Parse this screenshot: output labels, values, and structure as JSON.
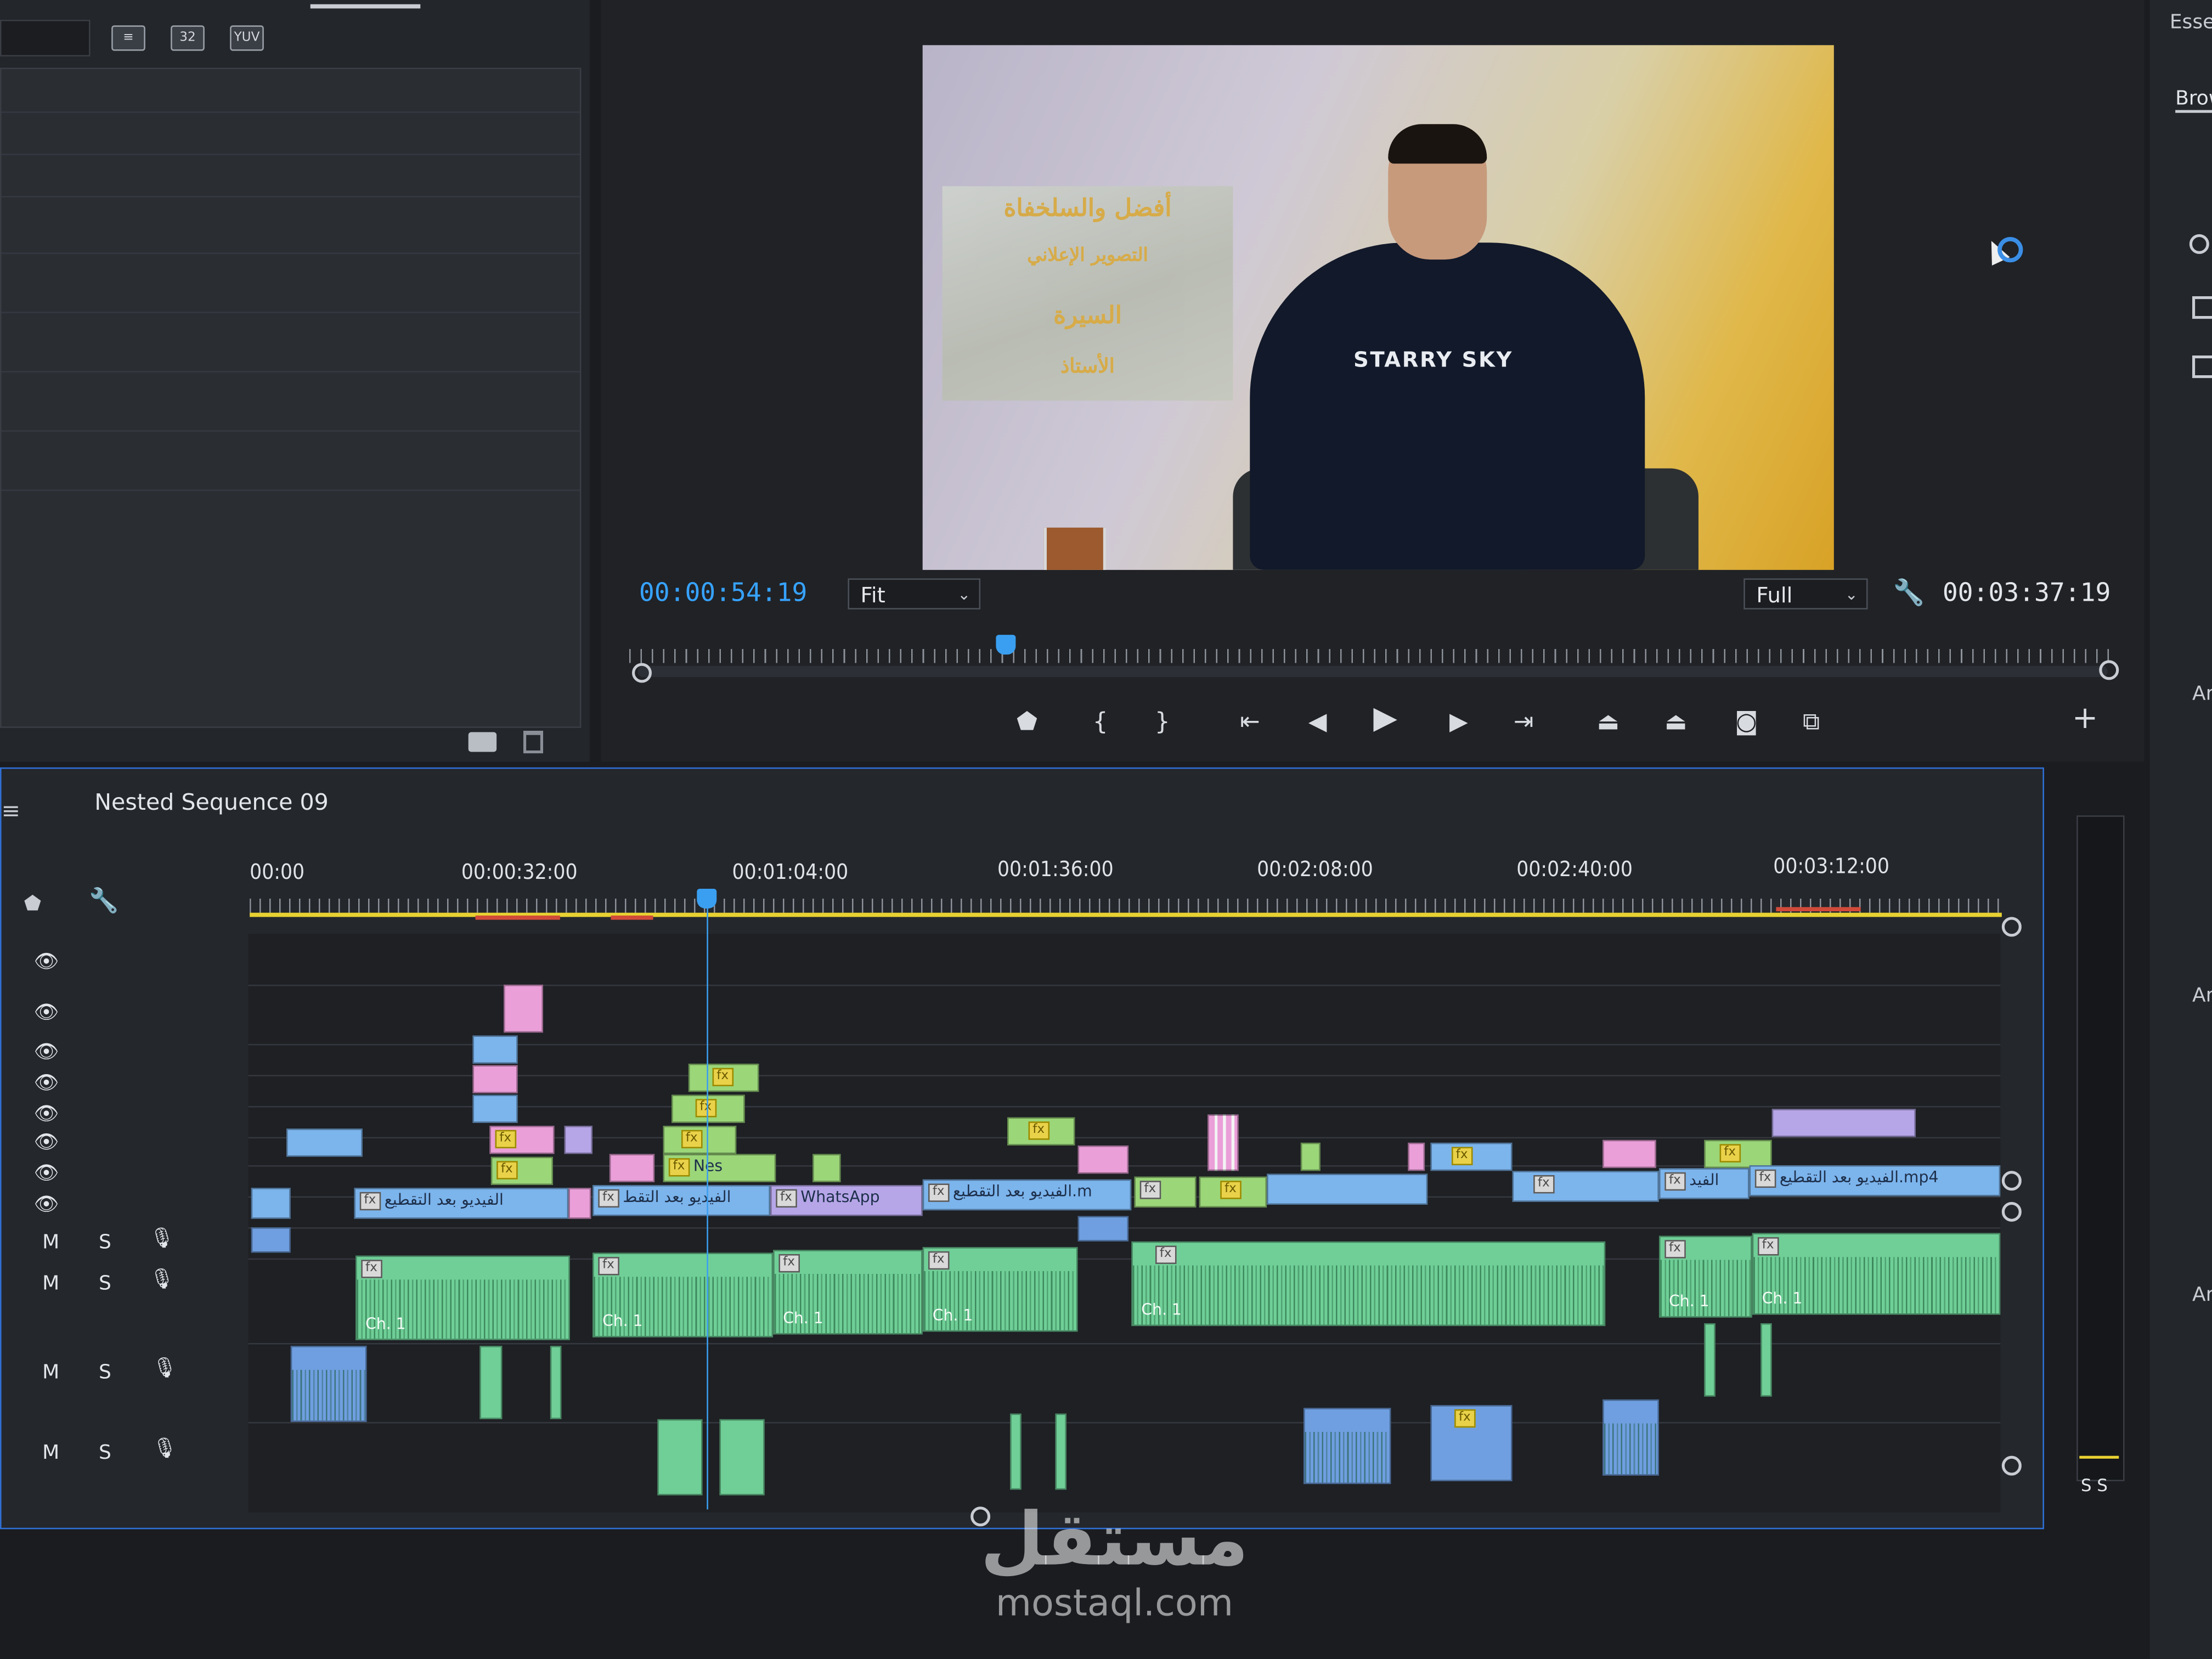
{
  "project_panel": {
    "tool_icons": [
      "list-view-icon",
      "32",
      "YUV"
    ]
  },
  "program_monitor": {
    "current_timecode": "00:00:54:19",
    "zoom": "Fit",
    "resolution": "Full",
    "duration": "00:03:37:19",
    "playhead_fraction": 0.25,
    "poster_lines": [
      "أفضل والسلخفاة",
      "التصوير الإعلاني",
      "السيرة",
      "الأستاذ"
    ],
    "hoodie_text": "STARRY SKY",
    "controls": [
      "marker-icon",
      "mark-in-icon",
      "mark-out-icon",
      "go-to-in-icon",
      "step-back-icon",
      "play-icon",
      "step-forward-icon",
      "go-to-out-icon",
      "lift-icon",
      "extract-icon",
      "export-frame-icon",
      "compare-view-icon",
      "add-button-icon"
    ]
  },
  "right_panel": {
    "tab_top": "Esse",
    "tab_browse": "Brow",
    "labels": [
      "Ar",
      "Ar",
      "Ar"
    ]
  },
  "timeline": {
    "sequence_name": "Nested Sequence 09",
    "ruler": [
      "00:00",
      "00:00:32:00",
      "00:01:04:00",
      "00:01:36:00",
      "00:02:08:00",
      "00:02:40:00",
      "00:03:12:00"
    ],
    "audio_track_buttons": {
      "mute": "M",
      "solo": "S"
    },
    "clip_labels": {
      "v1_a": "الفيديو بعد التقطيع",
      "v1_b": "الفيديو بعد التقط",
      "v1_c": "WhatsApp",
      "v1_d": "الفيديو بعد التقطيع.m",
      "v1_e": "الفيد",
      "v1_f": "الفيديو بعد التقطيع.mp4",
      "v2_nes": "Nes",
      "fx": "fx",
      "ch": "Ch. 1"
    },
    "meter_label": "S S"
  },
  "watermark": {
    "logo": "مستقل",
    "url": "mostaql.com"
  }
}
